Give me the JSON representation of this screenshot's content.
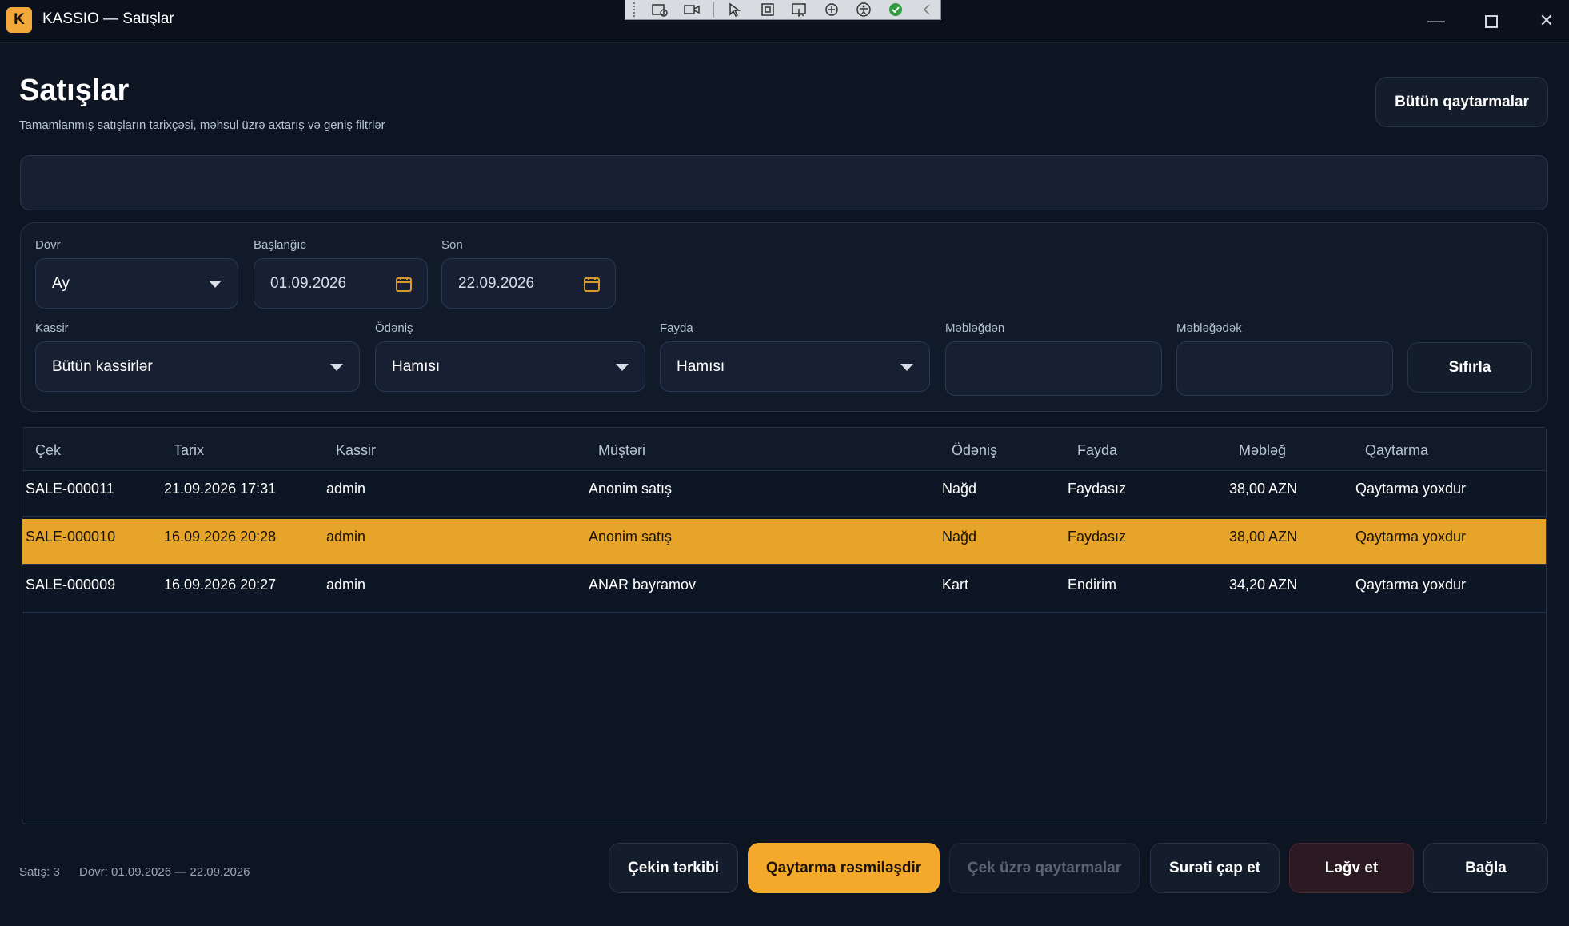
{
  "window": {
    "app_letter": "K",
    "title": "KASSIO — Satışlar",
    "min_glyph": "—",
    "close_glyph": "✕"
  },
  "header": {
    "title": "Satışlar",
    "subtitle": "Tamamlanmış satışların tarixçəsi, məhsul üzrə axtarış və geniş filtrlər",
    "all_returns_button": "Bütün qaytarmalar"
  },
  "search": {
    "value": "",
    "placeholder": ""
  },
  "filters": {
    "period": {
      "label": "Dövr",
      "value": "Ay"
    },
    "start": {
      "label": "Başlanğıc",
      "value": "01.09.2026"
    },
    "end": {
      "label": "Son",
      "value": "22.09.2026"
    },
    "cashier": {
      "label": "Kassir",
      "value": "Bütün kassirlər"
    },
    "payment": {
      "label": "Ödəniş",
      "value": "Hamısı"
    },
    "benefit": {
      "label": "Fayda",
      "value": "Hamısı"
    },
    "amount_from": {
      "label": "Məbləğdən",
      "value": ""
    },
    "amount_to": {
      "label": "Məbləğədək",
      "value": ""
    },
    "reset_button": "Sıfırla"
  },
  "table": {
    "columns": [
      "Çek",
      "Tarix",
      "Kassir",
      "Müştəri",
      "Ödəniş",
      "Fayda",
      "Məbləğ",
      "Qaytarma"
    ],
    "rows": [
      [
        "SALE-000011",
        "21.09.2026 17:31",
        "admin",
        "Anonim satış",
        "Nağd",
        "Faydasız",
        "38,00 AZN",
        "Qaytarma yoxdur"
      ],
      [
        "SALE-000010",
        "16.09.2026 20:28",
        "admin",
        "Anonim satış",
        "Nağd",
        "Faydasız",
        "38,00 AZN",
        "Qaytarma yoxdur"
      ],
      [
        "SALE-000009",
        "16.09.2026 20:27",
        "admin",
        "ANAR bayramov",
        "Kart",
        "Endirim",
        "34,20 AZN",
        "Qaytarma yoxdur"
      ]
    ],
    "selected_row": 1
  },
  "footer": {
    "count_text": "Satış: 3",
    "period_text": "Dövr: 01.09.2026 — 22.09.2026",
    "buttons": {
      "details": "Çekin tərkibi",
      "make_return": "Qaytarma rəsmiləşdir",
      "check_returns": "Çek üzrə qaytarmalar",
      "print_copy": "Surəti çap et",
      "cancel": "Ləğv et",
      "close": "Bağla"
    }
  },
  "colors": {
    "accent": "#f5a92a",
    "background": "#0d1422",
    "selected_row": "#e6a42a",
    "cancel_button": "#2b1a22"
  }
}
